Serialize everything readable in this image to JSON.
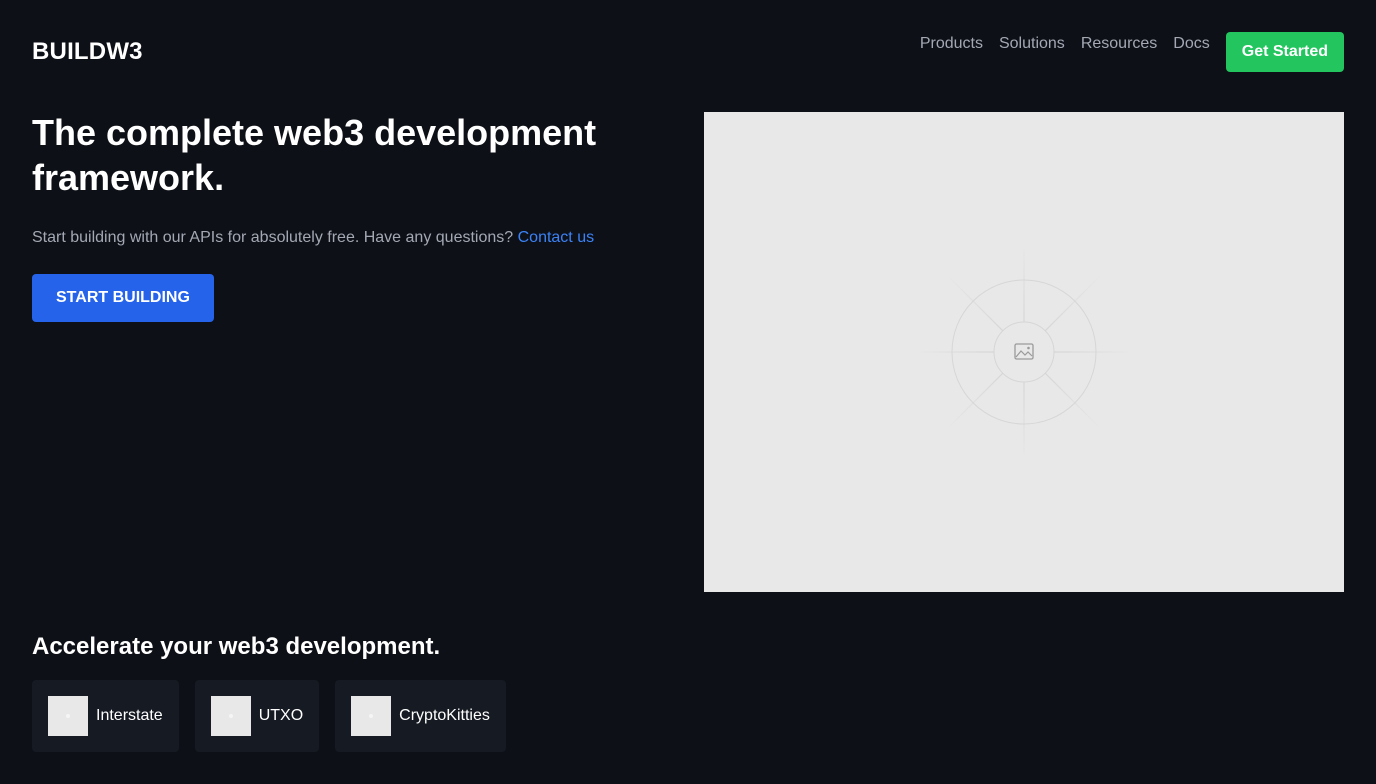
{
  "header": {
    "logo": "BUILDW3",
    "nav": [
      {
        "label": "Products"
      },
      {
        "label": "Solutions"
      },
      {
        "label": "Resources"
      },
      {
        "label": "Docs"
      }
    ],
    "cta_label": "Get Started"
  },
  "hero": {
    "title": "The complete web3 development framework.",
    "subtitle": "Start building with our APIs for absolutely free. Have any questions?",
    "contact_link": "Contact us",
    "button_label": "START BUILDING",
    "image_icon": "image-placeholder-icon"
  },
  "section": {
    "title": "Accelerate your web3 development.",
    "partners": [
      {
        "name": "Interstate"
      },
      {
        "name": "UTXO"
      },
      {
        "name": "CryptoKitties"
      }
    ]
  },
  "colors": {
    "background": "#0d1017",
    "primary_button": "#2563eb",
    "cta_button": "#22c55e",
    "link": "#3b82f6",
    "muted_text": "#a3a8b3",
    "card_background": "#161a22"
  }
}
